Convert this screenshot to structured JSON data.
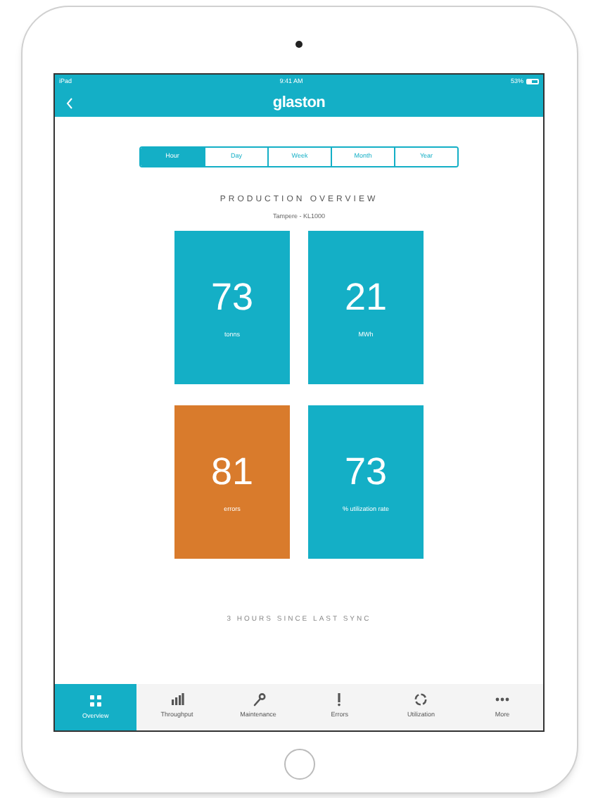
{
  "status_bar": {
    "device": "iPad",
    "time": "9:41 AM",
    "battery": "53%"
  },
  "nav": {
    "logo": "glaston"
  },
  "periods": [
    {
      "label": "Hour",
      "selected": true
    },
    {
      "label": "Day",
      "selected": false
    },
    {
      "label": "Week",
      "selected": false
    },
    {
      "label": "Month",
      "selected": false
    },
    {
      "label": "Year",
      "selected": false
    }
  ],
  "title": "PRODUCTION OVERVIEW",
  "subtitle": "Tampere - KL1000",
  "cards": [
    {
      "value": "73",
      "unit": "tonns",
      "color": "#14afc6"
    },
    {
      "value": "21",
      "unit": "MWh",
      "color": "#14afc6"
    },
    {
      "value": "81",
      "unit": "errors",
      "color": "#d97b2c"
    },
    {
      "value": "73",
      "unit": "% utilization rate",
      "color": "#14afc6"
    }
  ],
  "sync_note": "3 HOURS SINCE LAST SYNC",
  "tabs": [
    {
      "kind": "grid",
      "label": "Overview",
      "selected": true
    },
    {
      "kind": "bars",
      "label": "Throughput",
      "selected": false
    },
    {
      "kind": "wrench",
      "label": "Maintenance",
      "selected": false
    },
    {
      "kind": "exclaim",
      "label": "Errors",
      "selected": false
    },
    {
      "kind": "ring",
      "label": "Utilization",
      "selected": false
    },
    {
      "kind": "dots",
      "label": "More",
      "selected": false
    }
  ]
}
